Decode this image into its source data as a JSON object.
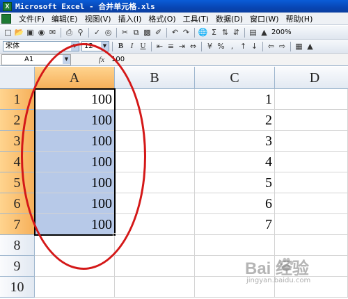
{
  "window": {
    "title": "Microsoft Excel - 合并单元格.xls",
    "app_icon_letter": "X"
  },
  "menu": {
    "items": [
      "文件(F)",
      "编辑(E)",
      "视图(V)",
      "插入(I)",
      "格式(O)",
      "工具(T)",
      "数据(D)",
      "窗口(W)",
      "帮助(H)"
    ]
  },
  "toolbar": {
    "zoom": "200%"
  },
  "format_toolbar": {
    "font_name": "宋体",
    "font_size": "12",
    "bold": "B",
    "italic": "I",
    "underline": "U",
    "percent": "%"
  },
  "formula_bar": {
    "name_box": "A1",
    "fx": "fx",
    "value": "100"
  },
  "sheet": {
    "columns": [
      "A",
      "B",
      "C",
      "D"
    ],
    "rows": [
      "1",
      "2",
      "3",
      "4",
      "5",
      "6",
      "7",
      "8",
      "9",
      "10"
    ],
    "column_a": [
      "100",
      "100",
      "100",
      "100",
      "100",
      "100",
      "100",
      "",
      "",
      ""
    ],
    "column_c": [
      "1",
      "2",
      "3",
      "4",
      "5",
      "6",
      "7",
      "",
      "",
      ""
    ],
    "selection": "A1:A7",
    "active_cell": "A1"
  },
  "colors": {
    "selection": "#b7c9e8",
    "active_header": "#f6b05a",
    "annotation": "#d41818",
    "title_bar": "#0846b4"
  },
  "watermark": {
    "main": "Bai 经验",
    "sub": "jingyan.baidu.com"
  }
}
